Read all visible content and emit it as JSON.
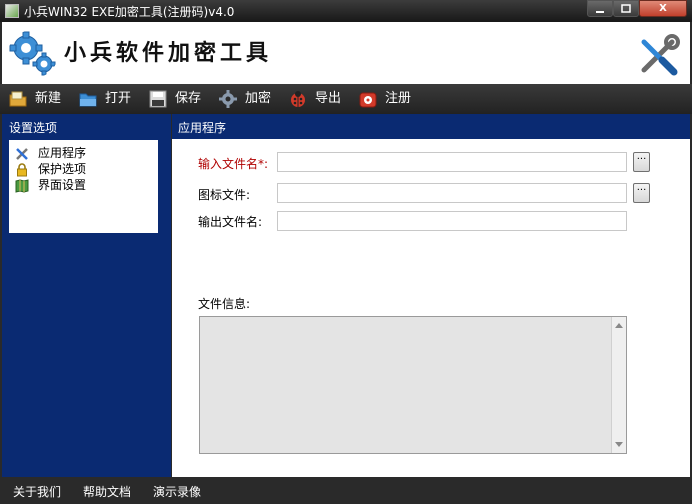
{
  "window": {
    "title": "小兵WIN32 EXE加密工具(注册码)v4.0",
    "close_label": "X"
  },
  "banner": {
    "brand": "小兵软件加密工具"
  },
  "toolbar": {
    "items": [
      {
        "label": "新建",
        "icon": "new-folder-icon"
      },
      {
        "label": "打开",
        "icon": "open-folder-icon"
      },
      {
        "label": "保存",
        "icon": "save-disk-icon"
      },
      {
        "label": "加密",
        "icon": "gear-icon"
      },
      {
        "label": "导出",
        "icon": "ladybug-icon"
      },
      {
        "label": "注册",
        "icon": "red-phone-icon"
      }
    ]
  },
  "sidebar": {
    "title": "设置选项",
    "items": [
      {
        "label": "应用程序",
        "icon": "tools-icon"
      },
      {
        "label": "保护选项",
        "icon": "lock-icon"
      },
      {
        "label": "界面设置",
        "icon": "map-icon"
      }
    ]
  },
  "main": {
    "title": "应用程序",
    "input_file_label": "输入文件名*:",
    "input_file_value": "",
    "icon_file_label": "图标文件:",
    "icon_file_value": "",
    "output_file_label": "输出文件名:",
    "output_file_value": "",
    "browse_label": "···",
    "file_info_label": "文件信息:",
    "file_info_value": ""
  },
  "status": {
    "links": [
      "关于我们",
      "帮助文档",
      "演示录像"
    ]
  },
  "colors": {
    "panel_blue": "#0a2a72",
    "required_red": "#b00000",
    "bar_dark": "#2a2a2a"
  }
}
